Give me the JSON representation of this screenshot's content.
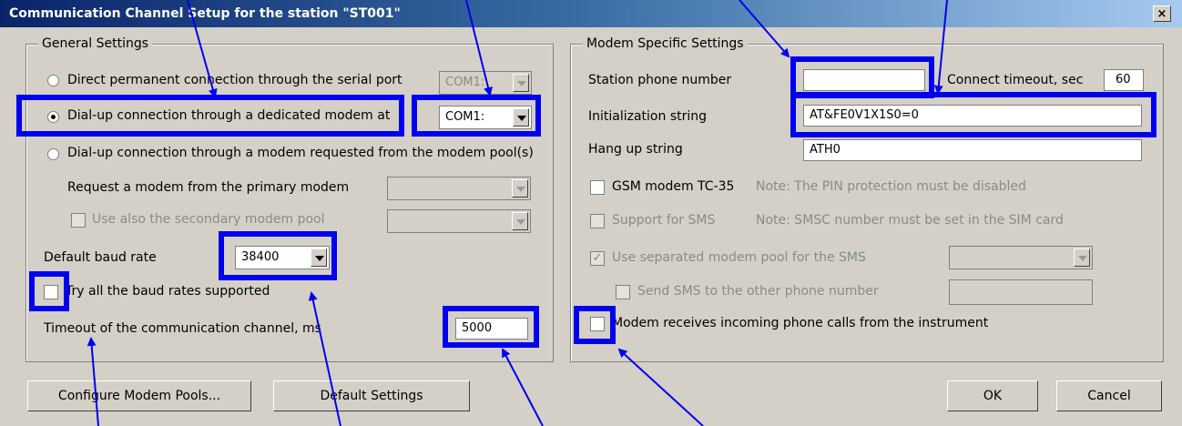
{
  "window": {
    "title": "Communication Channel Setup for the station \"ST001\"",
    "close": "×"
  },
  "general": {
    "legend": "General Settings",
    "direct_label": "Direct permanent connection through the serial port",
    "direct_port": "COM1:",
    "dialup_label": "Dial-up connection through a dedicated modem at",
    "dialup_port": "COM1:",
    "pool_label": "Dial-up connection through a modem requested from the modem pool(s)",
    "request_label": "Request a modem from the primary modem",
    "secondary_label": "Use also the secondary modem pool",
    "baud_label": "Default baud rate",
    "baud_value": "38400",
    "try_all_label": "Try all the baud rates supported",
    "timeout_label": "Timeout of the communication channel, ms",
    "timeout_value": "5000"
  },
  "modem": {
    "legend": "Modem Specific Settings",
    "phone_label": "Station phone number",
    "phone_value": "",
    "connect_label": "Connect timeout, sec",
    "connect_value": "60",
    "init_label": "Initialization string",
    "init_value": "AT&FE0V1X1S0=0",
    "hangup_label": "Hang up string",
    "hangup_value": "ATH0",
    "gsm_label": "GSM modem TC-35",
    "gsm_note": "Note: The PIN protection must be disabled",
    "sms_label": "Support for SMS",
    "sms_note": "Note: SMSC number must be set in the SIM card",
    "sep_pool_label": "Use separated modem pool for the SMS",
    "send_sms_label": "Send SMS to the other phone number",
    "incoming_label": "Modem receives incoming phone calls from the instrument"
  },
  "buttons": {
    "configure": "Configure Modem Pools...",
    "defaults": "Default Settings",
    "ok": "OK",
    "cancel": "Cancel"
  },
  "annotation_color": "#0000ee"
}
